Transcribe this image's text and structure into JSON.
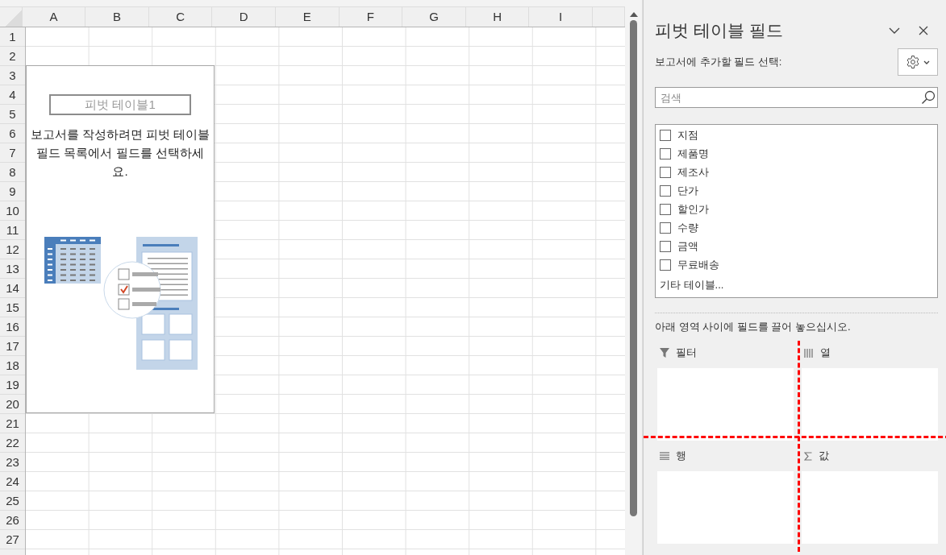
{
  "sheet": {
    "columns": [
      "A",
      "B",
      "C",
      "D",
      "E",
      "F",
      "G",
      "H",
      "I"
    ],
    "rows": [
      "1",
      "2",
      "3",
      "4",
      "5",
      "6",
      "7",
      "8",
      "9",
      "10",
      "11",
      "12",
      "13",
      "14",
      "15",
      "16",
      "17",
      "18",
      "19",
      "20",
      "21",
      "22",
      "23",
      "24",
      "25",
      "26",
      "27"
    ],
    "pivot_placeholder": {
      "title": "피벗 테이블1",
      "message": "보고서를 작성하려면 피벗 테이블 필드 목록에서 필드를 선택하세요."
    }
  },
  "panel": {
    "title": "피벗 테이블 필드",
    "subtitle": "보고서에 추가할 필드 선택:",
    "search": {
      "placeholder": "검색"
    },
    "fields": [
      {
        "label": "지점",
        "checked": false
      },
      {
        "label": "제품명",
        "checked": false
      },
      {
        "label": "제조사",
        "checked": false
      },
      {
        "label": "단가",
        "checked": false
      },
      {
        "label": "할인가",
        "checked": false
      },
      {
        "label": "수량",
        "checked": false
      },
      {
        "label": "금액",
        "checked": false
      },
      {
        "label": "무료배송",
        "checked": false
      }
    ],
    "more_tables": "기타 테이블...",
    "instruction": "아래 영역 사이에 필드를 끌어 놓으십시오.",
    "areas": [
      {
        "kind": "filter",
        "label": "필터"
      },
      {
        "kind": "columns",
        "label": "열"
      },
      {
        "kind": "rows",
        "label": "행"
      },
      {
        "kind": "values",
        "label": "값"
      }
    ]
  }
}
